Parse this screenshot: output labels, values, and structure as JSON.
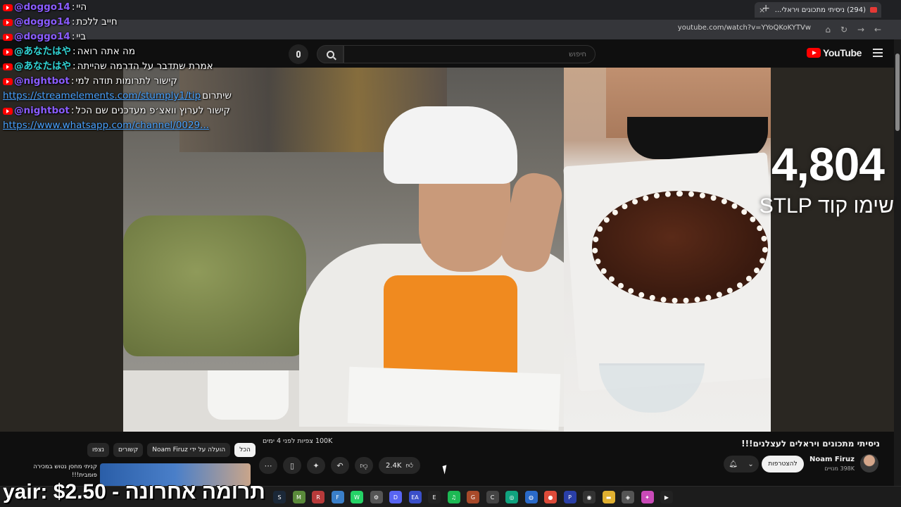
{
  "browser": {
    "tab_title": "(294) ניסיתי מתכונים ויראלי...",
    "new_tab": "+",
    "close": "×",
    "url": "youtube.com/watch?v=YYoQKoKYTVw"
  },
  "youtube": {
    "logo_text": "YouTube",
    "search_placeholder": "חיפוש"
  },
  "chat": [
    {
      "user": "@doggo14",
      "sep": ":",
      "msg": "היי",
      "color": "purple"
    },
    {
      "user": "@doggo14",
      "sep": ":",
      "msg": "חייב ללכת",
      "color": "purple"
    },
    {
      "user": "@doggo14",
      "sep": ":",
      "msg": "ביי",
      "color": "purple"
    },
    {
      "user": "@あなたはや",
      "sep": ":",
      "msg": "מה אתה רואה",
      "color": "cyan"
    },
    {
      "user": "@あなたはや",
      "sep": ":",
      "msg": "אמרת שתדבר על הדרמה שהייתה",
      "color": "cyan"
    },
    {
      "user": "@nightbot",
      "sep": ":",
      "msg": "קישור לתרומות תודה למי",
      "color": "purple"
    },
    {
      "user": "",
      "sep": "",
      "msg": "שיתרום",
      "link": "https://streamelements.com/stumply1/tip",
      "color": "purple"
    },
    {
      "user": "@nightbot",
      "sep": ":",
      "msg": "קישור לערוץ וואצ׳פ מעדכנים שם הכל",
      "color": "purple"
    },
    {
      "user": "",
      "sep": "",
      "msg": "",
      "link": "https://www.whatsapp.com/channel/0029...",
      "color": "purple"
    }
  ],
  "overlay": {
    "counter": "4,804",
    "code": "שימו קוד STLP"
  },
  "video": {
    "title": "ניסיתי מתכונים ויראלים לעצלנים!!!",
    "channel": "Noam Firuz",
    "subs": "398K מנויים",
    "join": "להצטרפות",
    "views": "100K צפיות  לפני 4 ימים",
    "likes": "2.4K",
    "chips": [
      "הכל",
      "הועלה על ידי Noam Firuz",
      "קשורים",
      "נצפו"
    ],
    "rec_title": "קניתי מחסן נטוש במכירה פומבית!!!"
  },
  "donation": "yair: תרומה אחרונה - $2.50",
  "taskbar_icons": [
    {
      "name": "steam-icon",
      "glyph": "S",
      "color": "#1b2838"
    },
    {
      "name": "minecraft-icon",
      "glyph": "M",
      "color": "#5a8a3a"
    },
    {
      "name": "red-app-icon",
      "glyph": "R",
      "color": "#b83a3a"
    },
    {
      "name": "files-icon",
      "glyph": "F",
      "color": "#3a7fc9"
    },
    {
      "name": "whatsapp-icon",
      "glyph": "W",
      "color": "#25d366"
    },
    {
      "name": "settings-icon",
      "glyph": "⚙",
      "color": "#555"
    },
    {
      "name": "discord-icon",
      "glyph": "D",
      "color": "#5865f2"
    },
    {
      "name": "ea-icon",
      "glyph": "EA",
      "color": "#3a4fc9"
    },
    {
      "name": "epic-icon",
      "glyph": "E",
      "color": "#222"
    },
    {
      "name": "spotify-icon",
      "glyph": "♫",
      "color": "#1db954"
    },
    {
      "name": "game-icon",
      "glyph": "G",
      "color": "#a84a2a"
    },
    {
      "name": "controller-icon",
      "glyph": "C",
      "color": "#444"
    },
    {
      "name": "chatgpt-icon",
      "glyph": "◎",
      "color": "#10a37f"
    },
    {
      "name": "globe-icon",
      "glyph": "◍",
      "color": "#2a6ac9"
    },
    {
      "name": "chrome-icon",
      "glyph": "●",
      "color": "#dd4b39"
    },
    {
      "name": "ps-icon",
      "glyph": "P",
      "color": "#2a3fa8"
    },
    {
      "name": "obs-icon",
      "glyph": "◉",
      "color": "#333"
    },
    {
      "name": "folder-icon",
      "glyph": "▬",
      "color": "#e0b030"
    },
    {
      "name": "app-icon",
      "glyph": "◈",
      "color": "#555"
    },
    {
      "name": "color-icon",
      "glyph": "✦",
      "color": "#c94ab8"
    },
    {
      "name": "capcut-icon",
      "glyph": "▶",
      "color": "#222"
    }
  ]
}
